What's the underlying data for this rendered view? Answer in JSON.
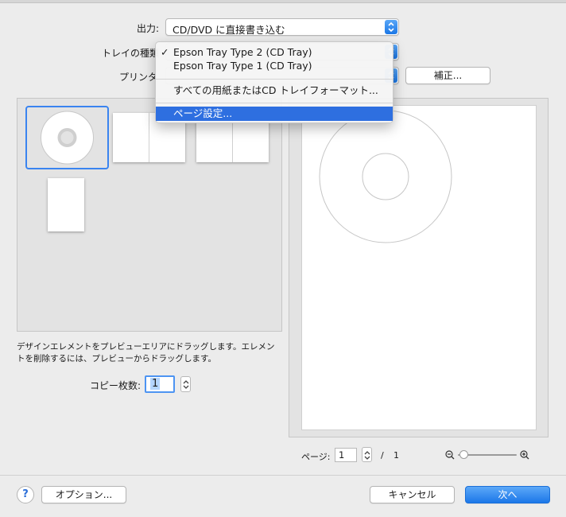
{
  "form": {
    "output_label": "出力:",
    "output_value": "CD/DVD に直接書き込む",
    "tray_label": "トレイの種類",
    "printer_label": "プリンタ",
    "adjust_button": "補正..."
  },
  "menu": {
    "items": [
      {
        "label": "Epson Tray Type 2 (CD Tray)",
        "checked": true,
        "check": "✓"
      },
      {
        "label": "Epson Tray Type 1 (CD Tray)",
        "checked": false
      },
      {
        "label": "すべての用紙またはCD トレイフォーマット...",
        "checked": false
      },
      {
        "label": "ページ設定...",
        "highlighted": true
      }
    ]
  },
  "layout_panel": {
    "description": "デザインエレメントをプレビューエリアにドラッグします。エレメントを削除するには、プレビューからドラッグします。",
    "copies_label": "コピー枚数:",
    "copies_value": "1",
    "thumbnail_icons": [
      "cd-layout-icon",
      "two-panel-layout-icon",
      "two-panel-wide-layout-icon",
      "single-page-layout-icon"
    ]
  },
  "preview": {
    "page_label": "ページ:",
    "page_value": "1",
    "page_separator": "/",
    "page_total": "1",
    "zoom_level": 0.1
  },
  "footer": {
    "help": "?",
    "options_button": "オプション...",
    "cancel_button": "キャンセル",
    "next_button": "次へ"
  },
  "colors": {
    "accent": "#1c77e8",
    "highlight": "#2e6fe0",
    "background": "#ececec"
  }
}
